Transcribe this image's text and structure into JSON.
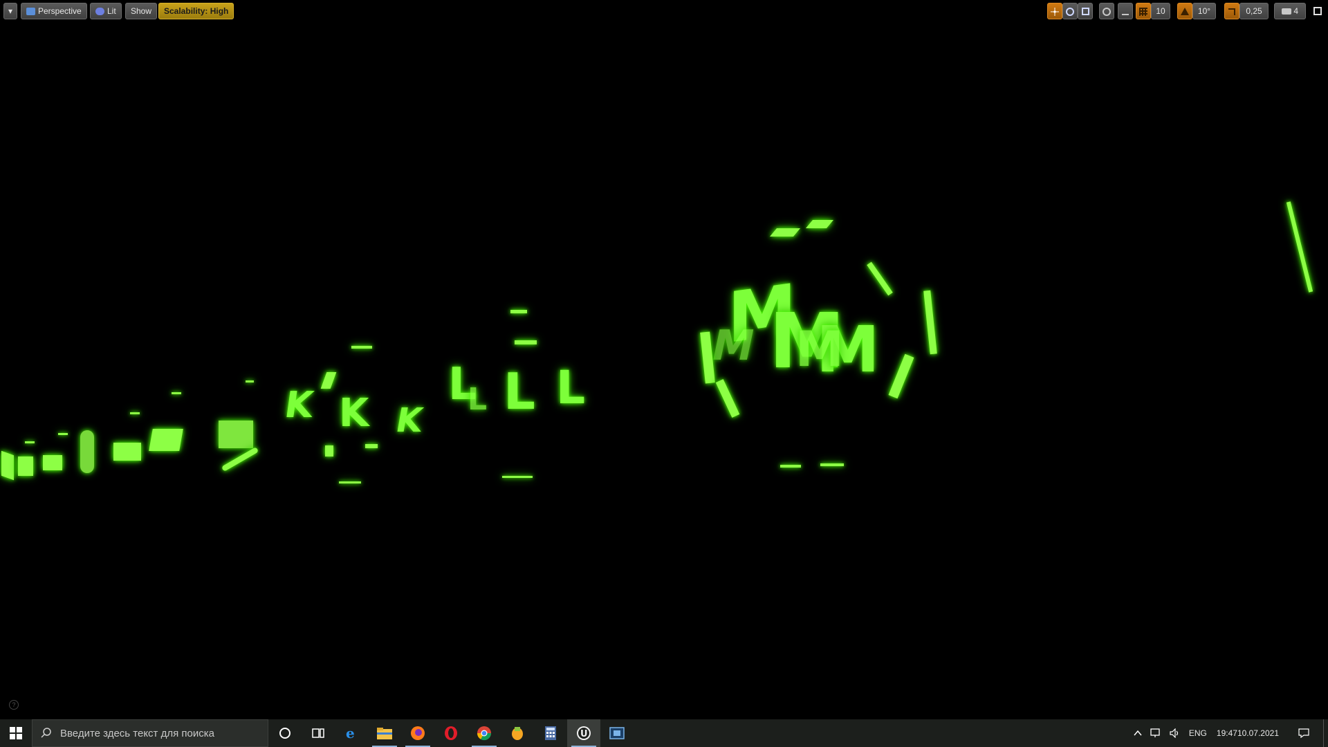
{
  "viewport_toolbar": {
    "menu_label": "▾",
    "perspective_label": "Perspective",
    "lit_label": "Lit",
    "show_label": "Show",
    "scalability_label": "Scalability: High",
    "grid_snap_value": "10",
    "rotation_snap_value": "10°",
    "scale_snap_value": "0,25",
    "camera_speed_value": "4"
  },
  "scene": {
    "glyph_color": "#7dff3a",
    "glyphs": [
      "K",
      "K",
      "K",
      "L",
      "L",
      "L",
      "L",
      "M",
      "M",
      "M",
      "M",
      "M"
    ]
  },
  "taskbar": {
    "search_placeholder": "Введите здесь текст для поиска",
    "apps": [
      "cortana-icon",
      "task-view-icon",
      "edge-icon",
      "file-explorer-icon",
      "firefox-icon",
      "opera-icon",
      "chrome-icon",
      "fl-studio-icon",
      "calculator-icon",
      "unreal-engine-icon",
      "media-app-icon"
    ],
    "language": "ENG",
    "time": "19:47",
    "date": "10.07.2021"
  },
  "colors": {
    "taskbar_bg": "#1c1f1c",
    "scalability_accent": "#c8a21a",
    "snap_accent": "#d07a12",
    "glow": "#4cff00"
  }
}
